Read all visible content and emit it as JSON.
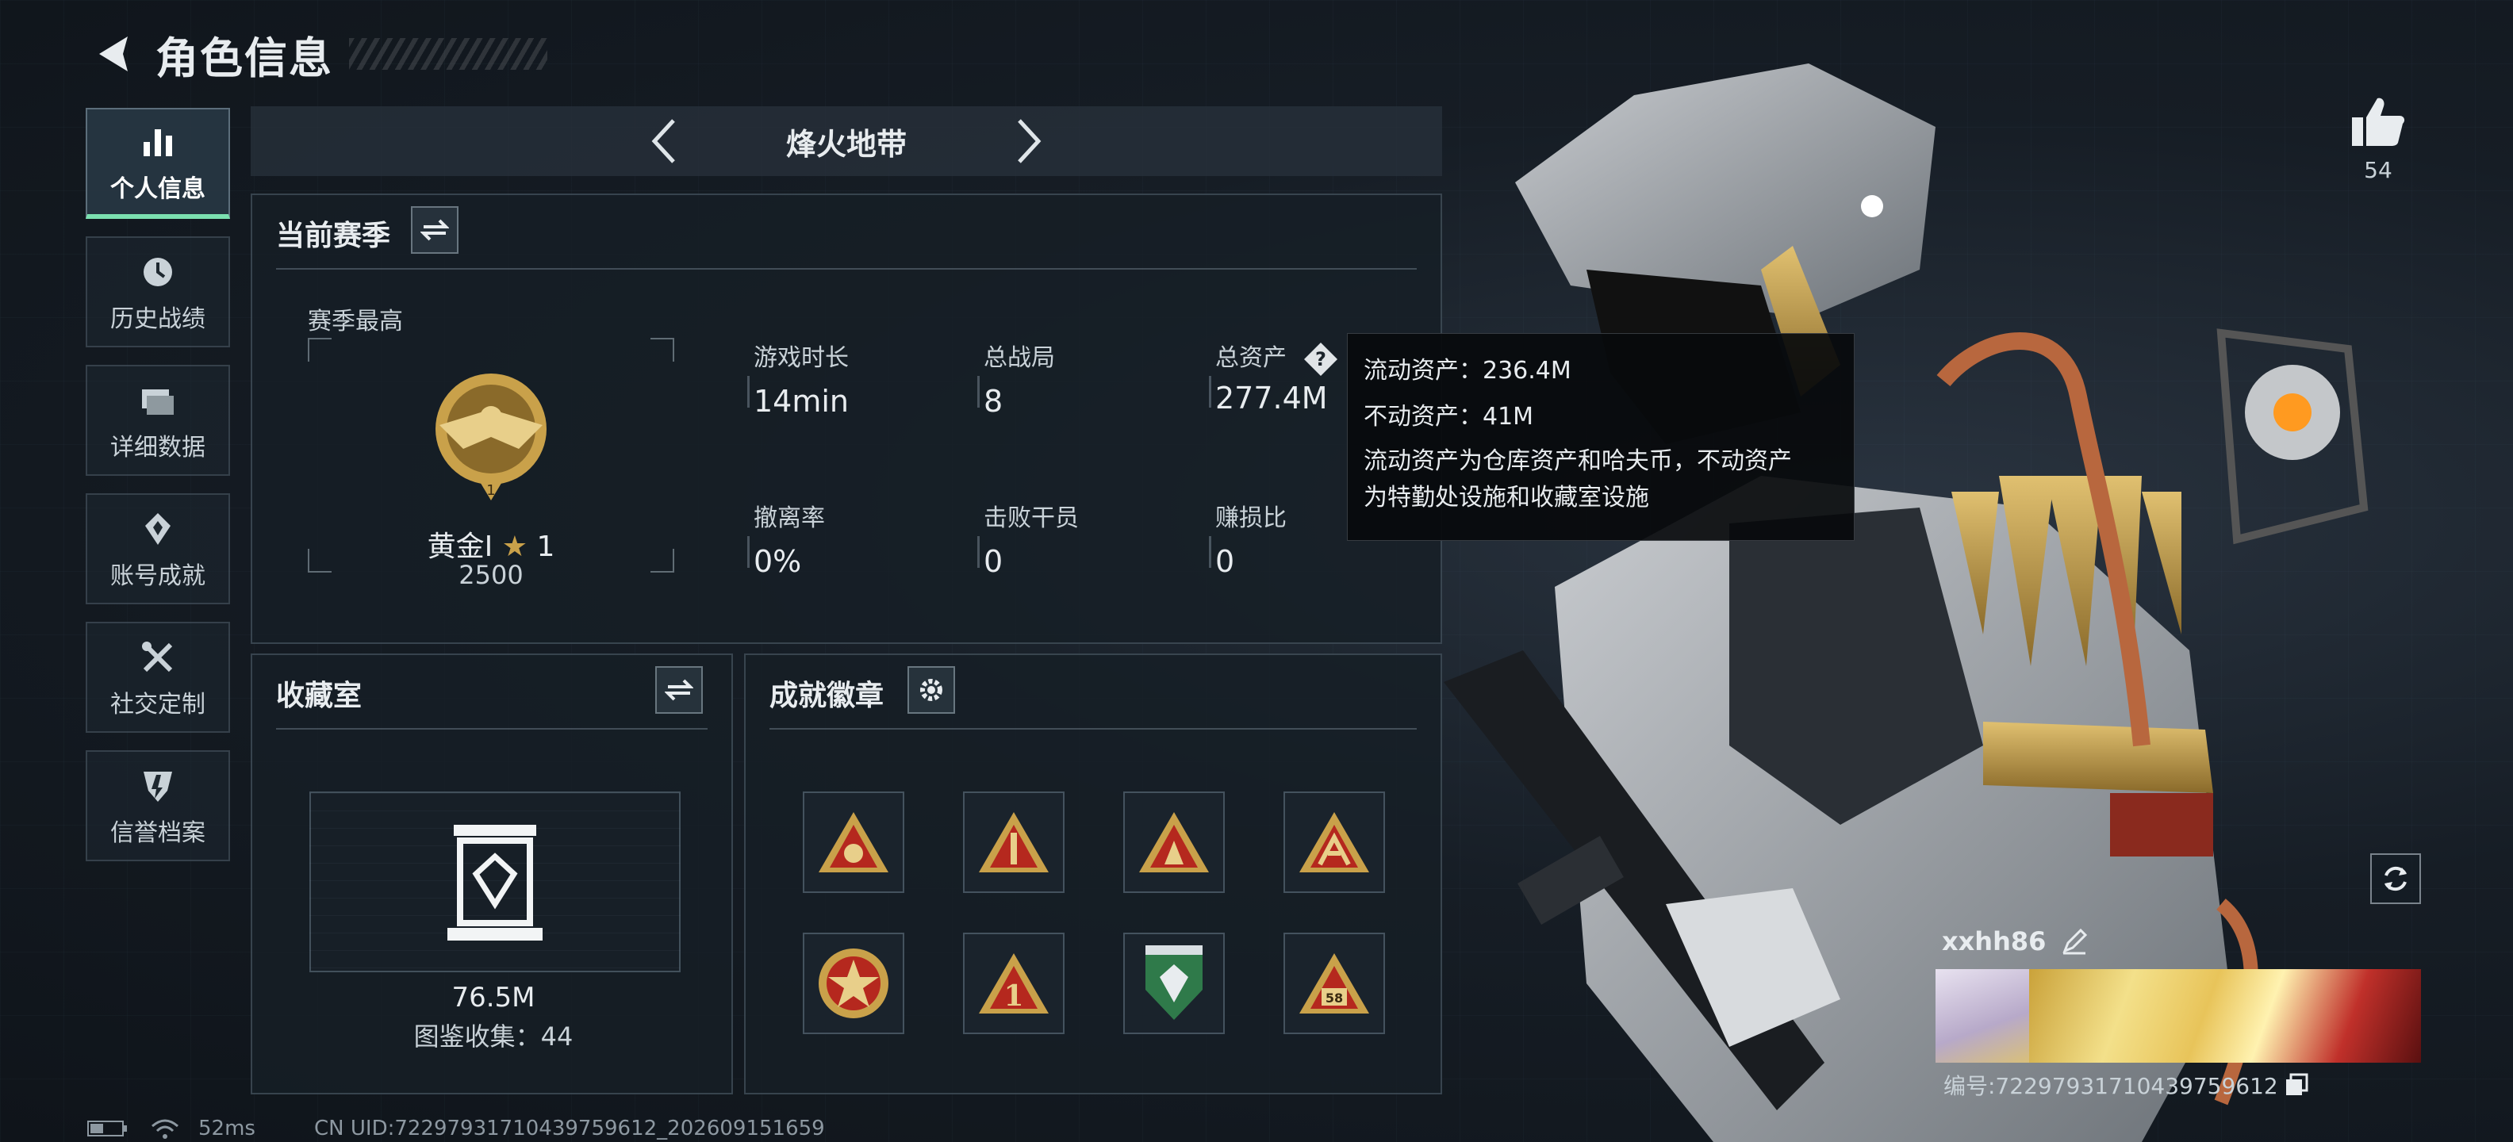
{
  "header": {
    "title": "角色信息"
  },
  "nav": {
    "items": [
      {
        "label": "个人信息",
        "icon": "bar-chart-icon",
        "active": true
      },
      {
        "label": "历史战绩",
        "icon": "history-clock-icon",
        "active": false
      },
      {
        "label": "详细数据",
        "icon": "folder-icon",
        "active": false
      },
      {
        "label": "账号成就",
        "icon": "medal-icon",
        "active": false
      },
      {
        "label": "社交定制",
        "icon": "tools-icon",
        "active": false
      },
      {
        "label": "信誉档案",
        "icon": "shield-icon",
        "active": false
      }
    ]
  },
  "mode": {
    "name": "烽火地带"
  },
  "season": {
    "title": "当前赛季",
    "best_label": "赛季最高",
    "rank_name": "黄金Ⅰ",
    "rank_stars": "1",
    "rank_score": "2500",
    "rank_level": "1",
    "stats": {
      "play_time": {
        "label": "游戏时长",
        "value": "14min"
      },
      "total_games": {
        "label": "总战局",
        "value": "8"
      },
      "total_assets": {
        "label": "总资产",
        "value": "277.4M"
      },
      "extraction_rate": {
        "label": "撤离率",
        "value": "0%"
      },
      "operators_defeated": {
        "label": "击败干员",
        "value": "0"
      },
      "profit_ratio": {
        "label": "赚损比",
        "value": "0"
      }
    }
  },
  "tooltip": {
    "liquid": "流动资产：236.4M",
    "fixed": "不动资产：41M",
    "desc_line1": "流动资产为仓库资产和哈夫币，不动资产",
    "desc_line2": "为特勤处设施和收藏室设施"
  },
  "collection": {
    "title": "收藏室",
    "value": "76.5M",
    "count": "图鉴收集：44"
  },
  "badges": {
    "title": "成就徽章",
    "badge_texts": [
      "1",
      "58"
    ]
  },
  "like": {
    "count": "54"
  },
  "player": {
    "name": "xxhh86",
    "uid": "编号:7229793171043975961​2"
  },
  "status": {
    "ping": "52ms",
    "cn_uid": "CN UID:7229793171043975961​2_202609151659"
  },
  "colors": {
    "accent": "#7be0b0",
    "gold": "#c9a14a",
    "badge_red": "#b5281e"
  }
}
